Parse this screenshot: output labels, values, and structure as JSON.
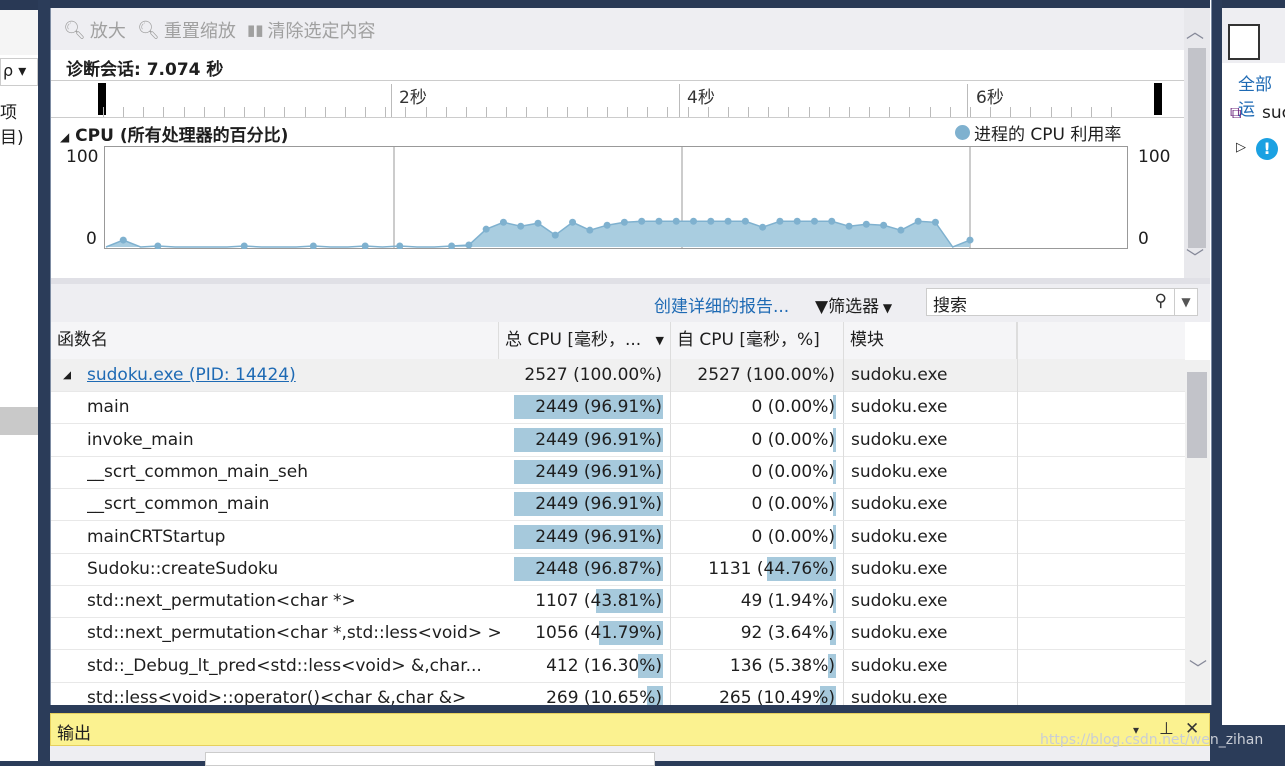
{
  "left_panel": {
    "project_fragment": "项目)",
    "search_fragment": "ρ ▾"
  },
  "toolbar": {
    "zoom_in": "放大",
    "reset_zoom": "重置缩放",
    "clear_selection": "清除选定内容"
  },
  "session": {
    "label": "诊断会话: 7.074 秒"
  },
  "ruler": {
    "labels": [
      "2秒",
      "4秒",
      "6秒"
    ]
  },
  "cpu": {
    "title": "CPU (所有处理器的百分比)",
    "legend": "进程的 CPU 利用率",
    "y_max": "100",
    "y_min": "0",
    "color": "#7fb1cf"
  },
  "chart_data": {
    "type": "area",
    "x": [
      0,
      0.12,
      0.24,
      0.36,
      0.48,
      0.6,
      0.72,
      0.84,
      0.96,
      1.08,
      1.2,
      1.32,
      1.44,
      1.56,
      1.68,
      1.8,
      1.92,
      2.04,
      2.16,
      2.28,
      2.4,
      2.52,
      2.64,
      2.76,
      2.88,
      3.0,
      3.12,
      3.24,
      3.36,
      3.48,
      3.6,
      3.72,
      3.84,
      3.96,
      4.08,
      4.2,
      4.32,
      4.44,
      4.56,
      4.68,
      4.8,
      4.92,
      5.04,
      5.16,
      5.28,
      5.4,
      5.52,
      5.64,
      5.76,
      5.88,
      6.0
    ],
    "y": [
      0,
      7,
      0,
      1,
      0,
      0,
      0,
      0,
      1,
      0,
      0,
      0,
      1,
      0,
      0,
      1,
      0,
      1,
      0,
      0,
      1,
      2,
      18,
      25,
      21,
      24,
      12,
      25,
      17,
      22,
      25,
      26,
      26,
      26,
      26,
      26,
      26,
      26,
      20,
      26,
      26,
      26,
      26,
      21,
      23,
      22,
      17,
      26,
      25,
      0,
      7
    ],
    "ylim": [
      0,
      100
    ],
    "xlim": [
      0,
      7.074
    ]
  },
  "actions": {
    "report_link": "创建详细的报告...",
    "filter": "筛选器",
    "search_placeholder": "搜索"
  },
  "table": {
    "headers": [
      "函数名",
      "总 CPU [毫秒，...",
      "自 CPU [毫秒，%]",
      "模块"
    ],
    "rows": [
      {
        "name": "sudoku.exe (PID: 14424)",
        "total": "2527 (100.00%)",
        "self": "2527 (100.00%)",
        "module": "sudoku.exe",
        "total_pct": 100,
        "self_pct": 100
      },
      {
        "name": "main",
        "total": "2449 (96.91%)",
        "self": "0 (0.00%)",
        "module": "sudoku.exe",
        "total_pct": 96.91,
        "self_pct": 0
      },
      {
        "name": "invoke_main",
        "total": "2449 (96.91%)",
        "self": "0 (0.00%)",
        "module": "sudoku.exe",
        "total_pct": 96.91,
        "self_pct": 0
      },
      {
        "name": "__scrt_common_main_seh",
        "total": "2449 (96.91%)",
        "self": "0 (0.00%)",
        "module": "sudoku.exe",
        "total_pct": 96.91,
        "self_pct": 0
      },
      {
        "name": "__scrt_common_main",
        "total": "2449 (96.91%)",
        "self": "0 (0.00%)",
        "module": "sudoku.exe",
        "total_pct": 96.91,
        "self_pct": 0
      },
      {
        "name": "mainCRTStartup",
        "total": "2449 (96.91%)",
        "self": "0 (0.00%)",
        "module": "sudoku.exe",
        "total_pct": 96.91,
        "self_pct": 0
      },
      {
        "name": "Sudoku::createSudoku",
        "total": "2448 (96.87%)",
        "self": "1131 (44.76%)",
        "module": "sudoku.exe",
        "total_pct": 96.87,
        "self_pct": 44.76
      },
      {
        "name": "std::next_permutation<char *>",
        "total": "1107 (43.81%)",
        "self": "49 (1.94%)",
        "module": "sudoku.exe",
        "total_pct": 43.81,
        "self_pct": 1.94
      },
      {
        "name": "std::next_permutation<char *,std::less<void> >",
        "total": "1056 (41.79%)",
        "self": "92 (3.64%)",
        "module": "sudoku.exe",
        "total_pct": 41.79,
        "self_pct": 3.64
      },
      {
        "name": "std::_Debug_lt_pred<std::less<void> &,char...",
        "total": "412 (16.30%)",
        "self": "136 (5.38%)",
        "module": "sudoku.exe",
        "total_pct": 16.3,
        "self_pct": 5.38
      },
      {
        "name": "std::less<void>::operator()<char &,char &>",
        "total": "269 (10.65%)",
        "self": "265 (10.49%)",
        "module": "sudoku.exe",
        "total_pct": 10.65,
        "self_pct": 10.49
      }
    ]
  },
  "output": {
    "title": "输出",
    "dropdown": "▾",
    "pin": "⊥",
    "close": "✕"
  },
  "right_panel": {
    "all_label": "全部运",
    "item1": "suc"
  },
  "watermark": "https://blog.csdn.net/wen_zihan"
}
